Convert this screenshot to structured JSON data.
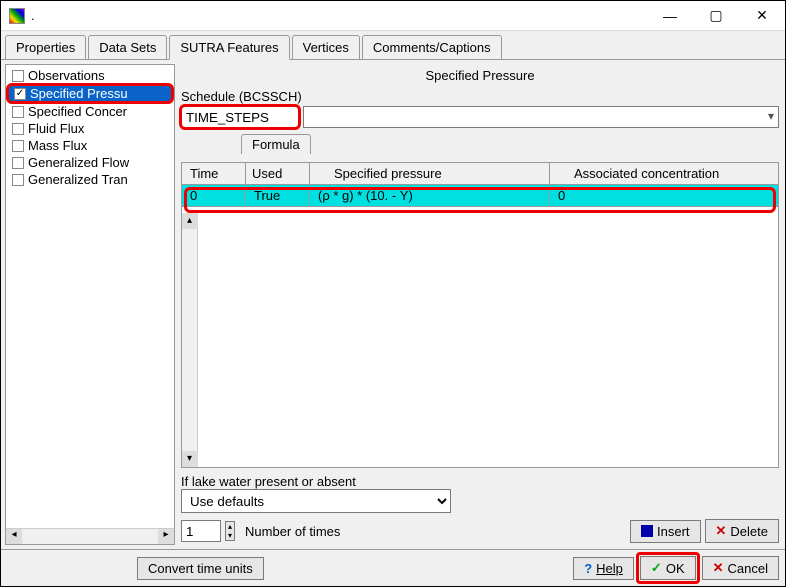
{
  "title": ".",
  "tabs": {
    "properties": "Properties",
    "datasets": "Data Sets",
    "sutra": "SUTRA Features",
    "vertices": "Vertices",
    "comments": "Comments/Captions"
  },
  "tree": {
    "items": [
      {
        "label": "Observations",
        "checked": false
      },
      {
        "label": "Specified Pressu",
        "checked": true,
        "selected": true,
        "highlight": true
      },
      {
        "label": "Specified Concer",
        "checked": false
      },
      {
        "label": "Fluid Flux",
        "checked": false
      },
      {
        "label": "Mass Flux",
        "checked": false
      },
      {
        "label": "Generalized Flow",
        "checked": false
      },
      {
        "label": "Generalized Tran",
        "checked": false
      }
    ]
  },
  "panel": {
    "heading": "Specified Pressure",
    "schedule_label": "Schedule (BCSSCH)",
    "schedule_value": "TIME_STEPS",
    "formula_tab": "Formula",
    "columns": {
      "time": "Time",
      "used": "Used",
      "pressure": "Specified pressure",
      "conc": "Associated concentration"
    },
    "row": {
      "time": "0",
      "used": "True",
      "pressure": "(ρ * g) * (10. - Y)",
      "conc": "0"
    },
    "lake_label": "If lake water present or absent",
    "lake_value": "Use defaults",
    "ntimes_value": "1",
    "ntimes_label": "Number of times",
    "insert": "Insert",
    "delete": "Delete"
  },
  "footer": {
    "convert": "Convert time units",
    "help": "Help",
    "ok": "OK",
    "cancel": "Cancel"
  }
}
